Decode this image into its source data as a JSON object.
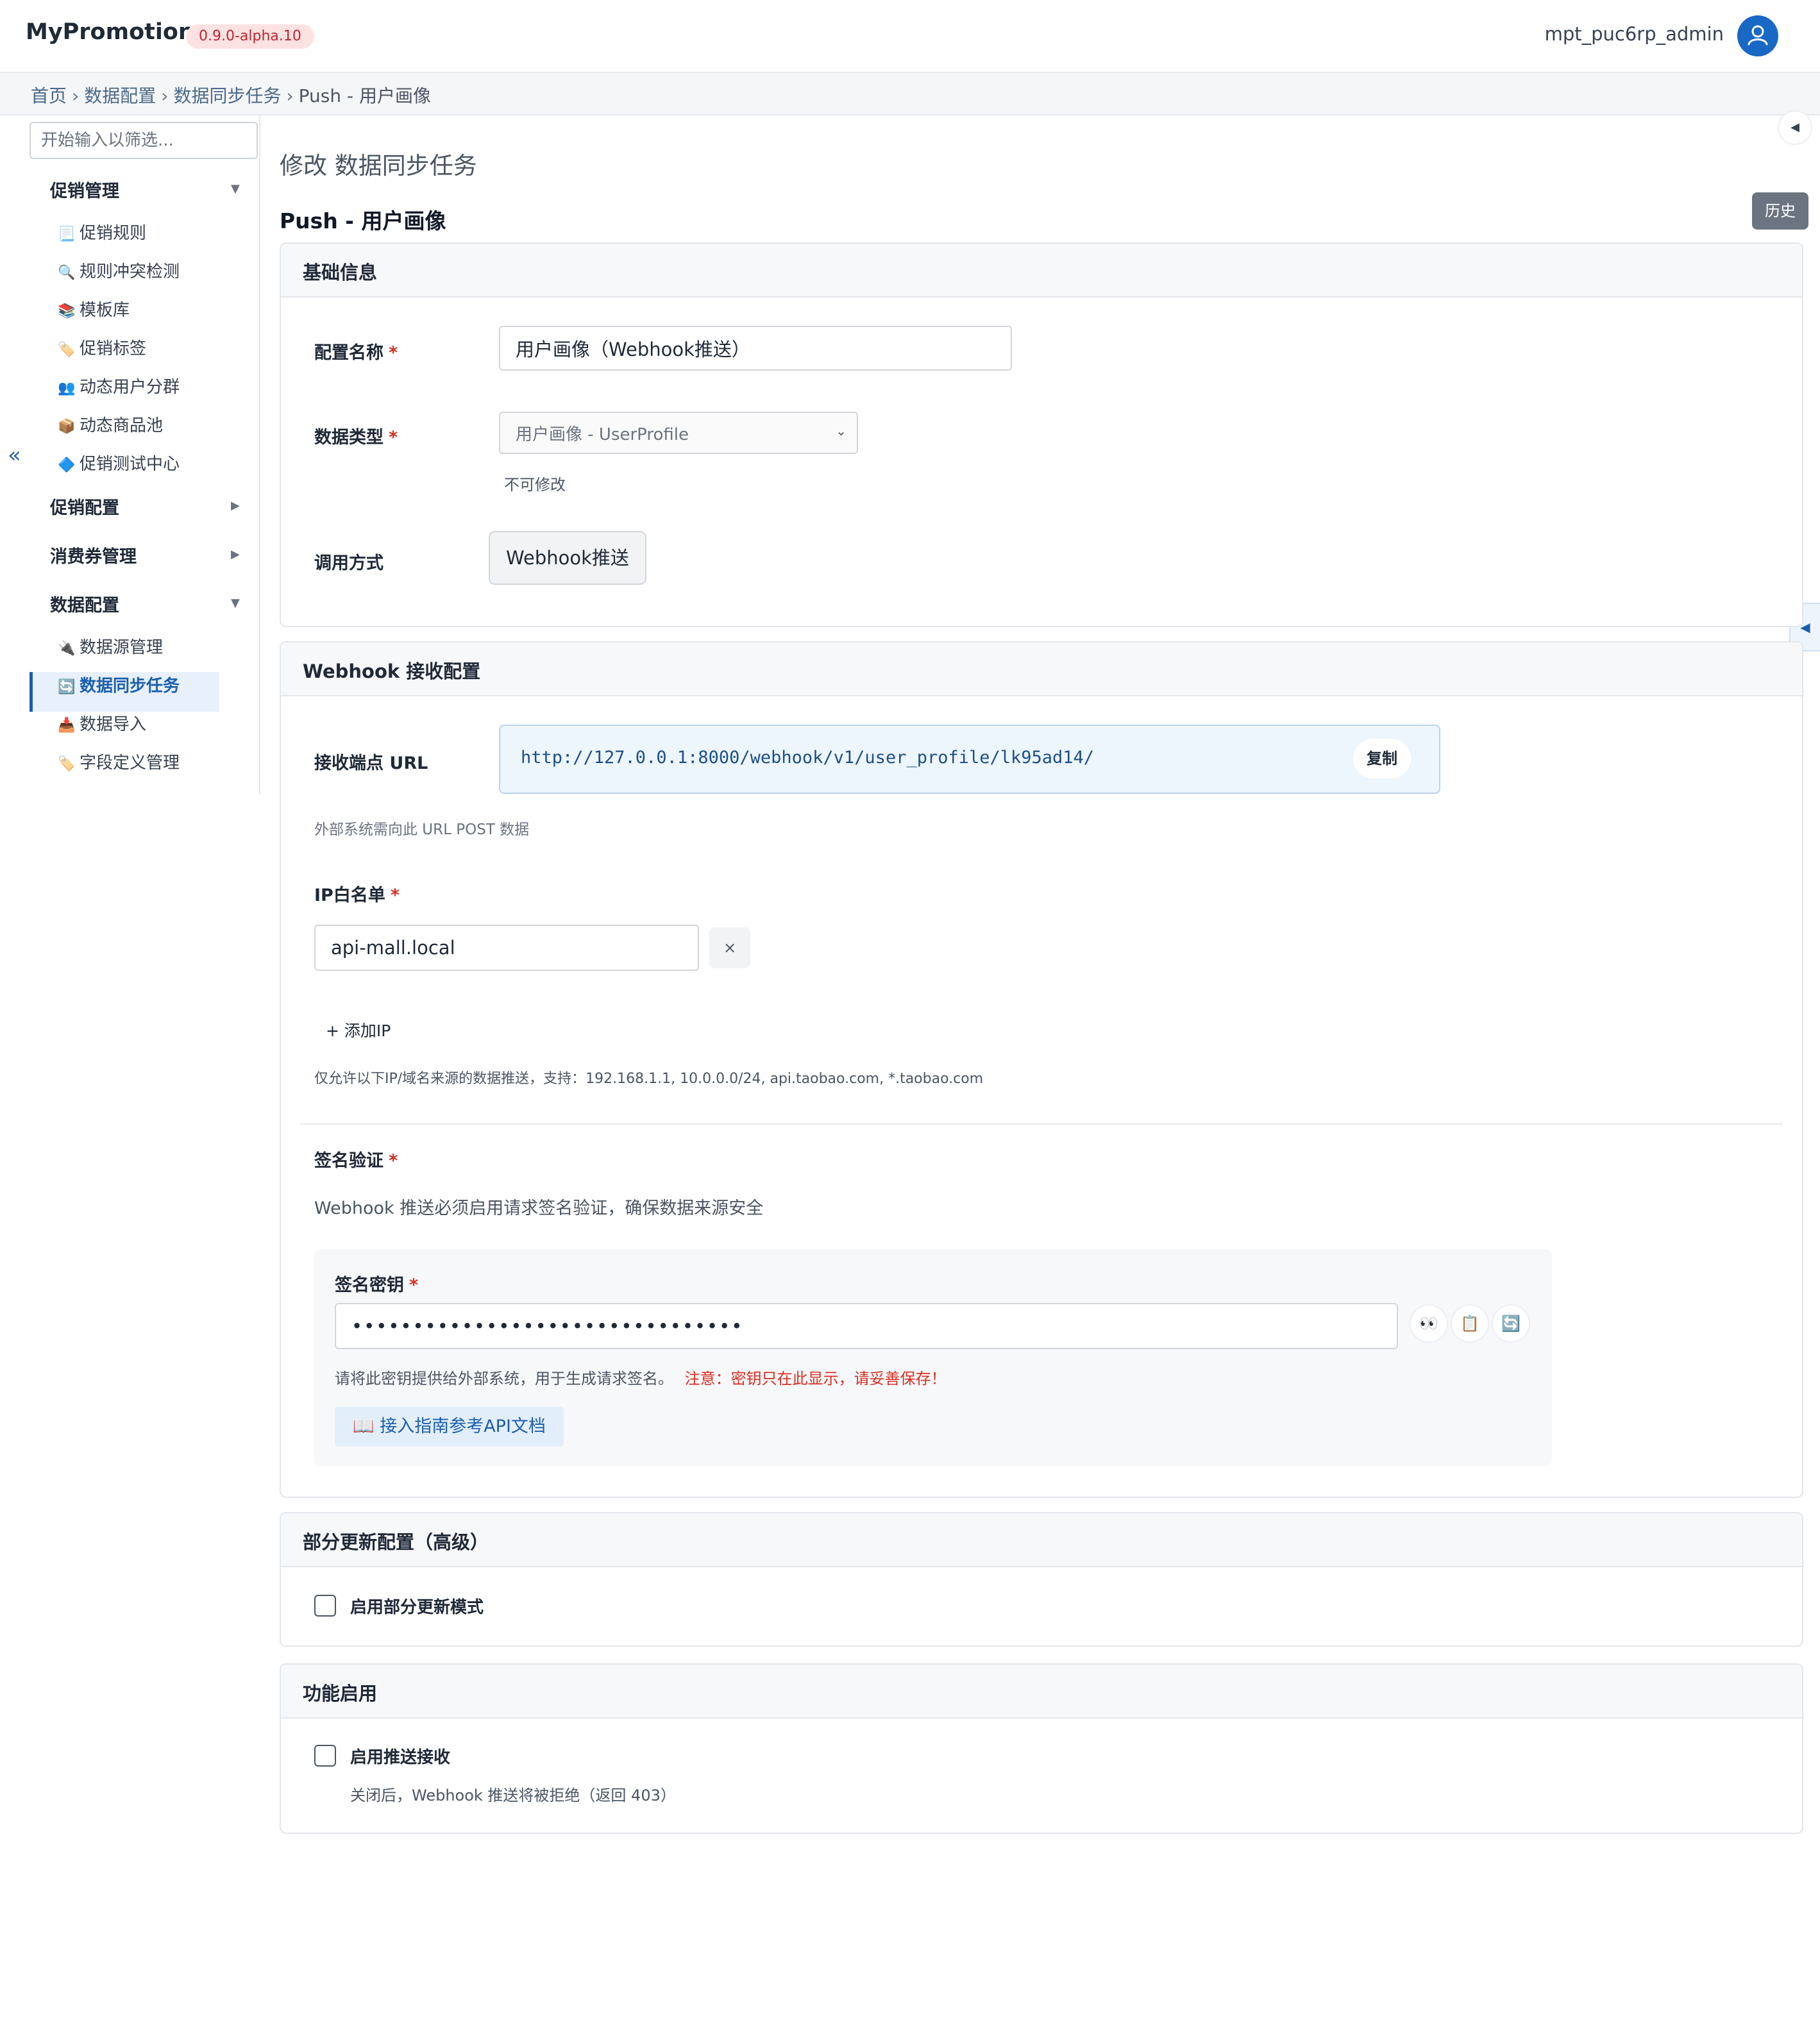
{
  "app": {
    "name": "MyPromotion",
    "version": "0.9.0-alpha.10",
    "username": "mpt_puc6rp_admin"
  },
  "breadcrumb": [
    "首页",
    "数据配置",
    "数据同步任务",
    "Push - 用户画像"
  ],
  "sidebar": {
    "filter_placeholder": "开始输入以筛选...",
    "collapse_icon": "«",
    "groups": [
      {
        "label": "促销管理",
        "expanded": true,
        "items": [
          {
            "icon": "📃",
            "label": "促销规则"
          },
          {
            "icon": "🔍",
            "label": "规则冲突检测"
          },
          {
            "icon": "📚",
            "label": "模板库"
          },
          {
            "icon": "🏷️",
            "label": "促销标签"
          },
          {
            "icon": "👥",
            "label": "动态用户分群"
          },
          {
            "icon": "📦",
            "label": "动态商品池"
          },
          {
            "icon": "🔷",
            "label": "促销测试中心"
          }
        ]
      },
      {
        "label": "促销配置",
        "expanded": false
      },
      {
        "label": "消费券管理",
        "expanded": false
      },
      {
        "label": "数据配置",
        "expanded": true,
        "items": [
          {
            "icon": "🔌",
            "label": "数据源管理"
          },
          {
            "icon": "🔄",
            "label": "数据同步任务",
            "active": true
          },
          {
            "icon": "📥",
            "label": "数据导入"
          },
          {
            "icon": "🏷️",
            "label": "字段定义管理"
          }
        ]
      }
    ]
  },
  "main": {
    "page_title": "修改 数据同步任务",
    "subtitle": "Push - 用户画像",
    "history_label": "历史",
    "basic": {
      "title": "基础信息",
      "name_label": "配置名称",
      "name_value": "用户画像（Webhook推送）",
      "type_label": "数据类型",
      "type_value": "用户画像 - UserProfile",
      "type_hint": "不可修改",
      "mode_label": "调用方式",
      "mode_value": "Webhook推送"
    },
    "webhook": {
      "title": "Webhook 接收配置",
      "url_label": "接收端点 URL",
      "url_value": "http://127.0.0.1:8000/webhook/v1/user_profile/lk95ad14/",
      "copy_label": "复制",
      "url_hint": "外部系统需向此 URL POST 数据",
      "ip_label": "IP白名单",
      "ip_value": "api-mall.local",
      "ip_remove": "×",
      "add_ip": "+ 添加IP",
      "ip_hint": "仅允许以下IP/域名来源的数据推送，支持：192.168.1.1, 10.0.0.0/24, api.taobao.com, *.taobao.com",
      "sign_label": "签名验证",
      "sign_desc": "Webhook 推送必须启用请求签名验证，确保数据来源安全",
      "secret_label": "签名密钥",
      "secret_value": "••••••••••••••••••••••••••••••••",
      "secret_icons": [
        "👀",
        "📋",
        "🔄"
      ],
      "secret_hint": "请将此密钥提供给外部系统，用于生成请求签名。",
      "secret_warning": "注意：密钥只在此显示，请妥善保存！",
      "api_doc": "📖 接入指南参考API文档"
    },
    "partial": {
      "title": "部分更新配置（高级）",
      "checkbox_label": "启用部分更新模式",
      "checked": false
    },
    "feature": {
      "title": "功能启用",
      "checkbox_label": "启用推送接收",
      "checked": false,
      "hint": "关闭后，Webhook 推送将被拒绝（返回 403）"
    }
  },
  "colors": {
    "primary": "#1b5fae",
    "danger": "#d92d20",
    "badge_bg": "#fde2e2"
  }
}
